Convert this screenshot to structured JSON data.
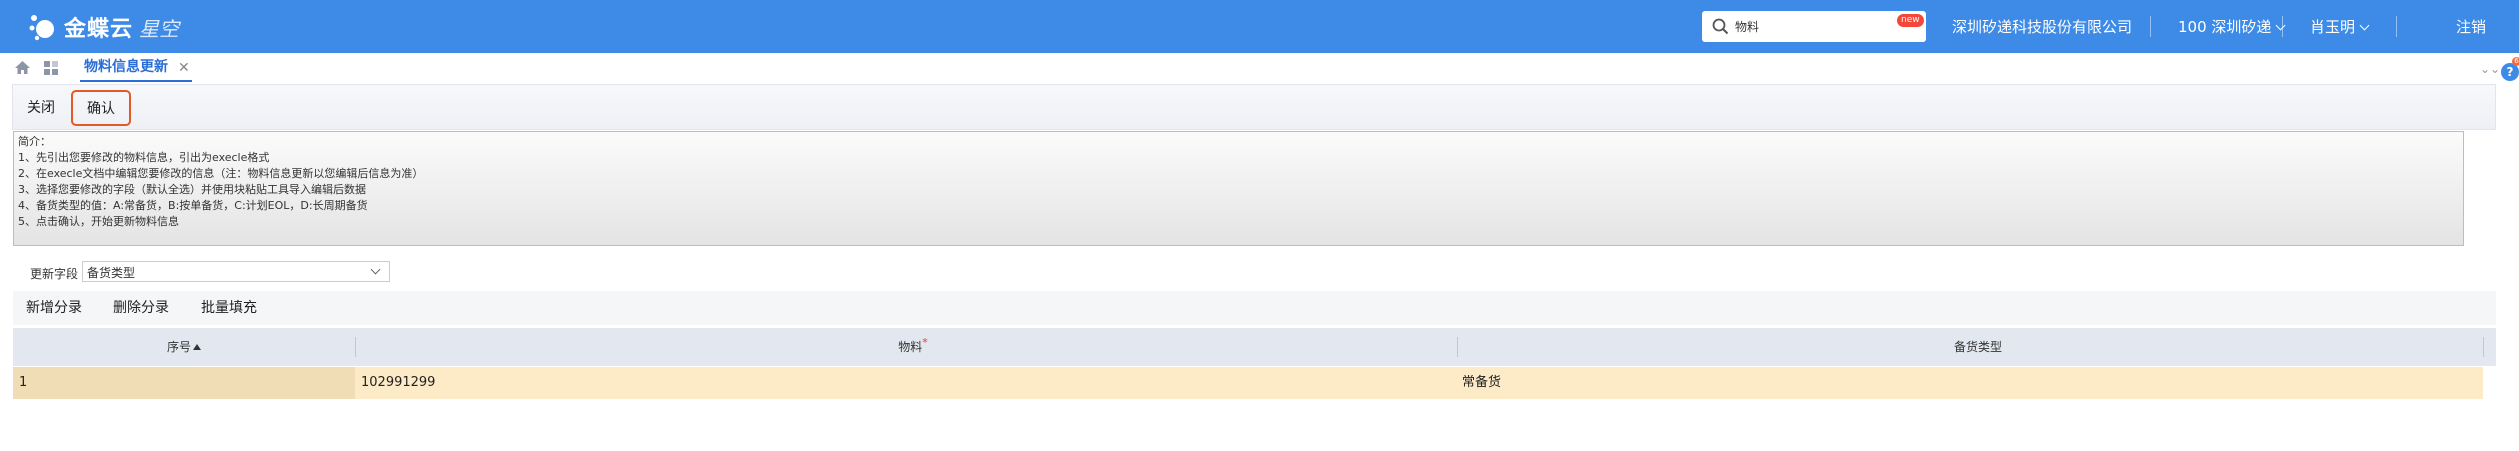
{
  "app": {
    "logo_main": "金蝶云",
    "logo_sub": "星空"
  },
  "search": {
    "value": "物料",
    "badge": "new"
  },
  "topnav": {
    "company": "深圳矽递科技股份有限公司",
    "org": "100 深圳矽递",
    "user": "肖玉明",
    "logout": "注销"
  },
  "tabs": [
    {
      "label": "物料信息更新",
      "active": true
    }
  ],
  "help": {
    "badge": "6"
  },
  "toolbar": {
    "close_label": "关闭",
    "confirm_label": "确认"
  },
  "intro": {
    "lines": [
      "简介：",
      "1、先引出您要修改的物料信息，引出为execle格式",
      "2、在execle文档中编辑您要修改的信息（注：物料信息更新以您编辑后信息为准）",
      "3、选择您要修改的字段（默认全选）并使用块粘贴工具导入编辑后数据",
      "4、备货类型的值：A:常备货，B:按单备货，C:计划EOL，D:长周期备货",
      "5、点击确认，开始更新物料信息"
    ]
  },
  "update_field": {
    "label": "更新字段",
    "value": "备货类型"
  },
  "grid_toolbar": {
    "add_label": "新增分录",
    "delete_label": "删除分录",
    "batch_label": "批量填充"
  },
  "grid": {
    "columns": [
      "序号",
      "物料",
      "备货类型"
    ],
    "rows": [
      {
        "seq": "1",
        "material": "102991299",
        "stock_type": "常备货"
      }
    ]
  },
  "colors": {
    "topbar": "#3d8ae7",
    "tab_active": "#2a6ed6",
    "confirm_highlight": "#e15a27",
    "row_selected": "#fdebc8"
  }
}
